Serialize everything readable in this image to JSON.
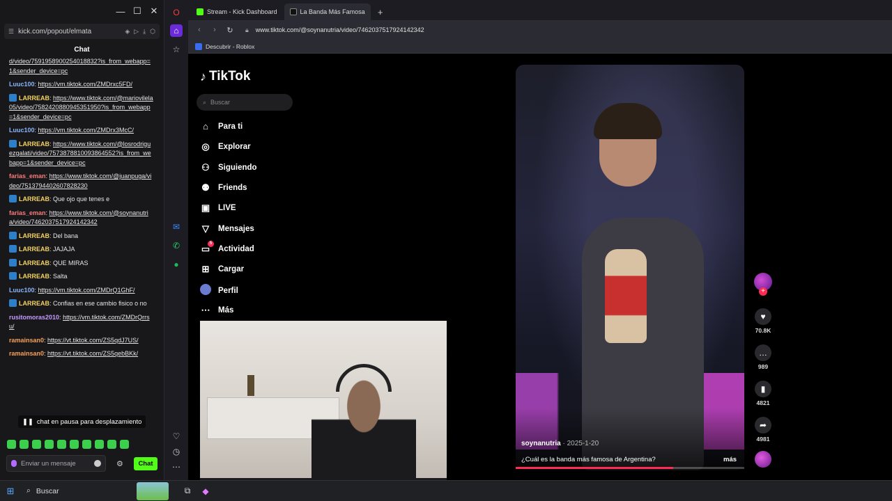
{
  "chat_window": {
    "url": "kick.com/popout/elmata",
    "header": "Chat",
    "messages": [
      {
        "user": "",
        "text": "d/video/7591958900254018832?is_from_webapp=1&sender_device=pc",
        "link": true,
        "color": "",
        "badge": false
      },
      {
        "user": "Luuc100",
        "text": "https://vm.tiktok.com/ZMDrxc5FD/",
        "link": true,
        "color": "blue",
        "badge": false
      },
      {
        "user": "LARREAB",
        "text": "https://www.tiktok.com/@mariovilela05/video/7582420880945351950?is_from_webapp=1&sender_device=pc",
        "link": true,
        "color": "yel",
        "badge": true
      },
      {
        "user": "Luuc100",
        "text": "https://vm.tiktok.com/ZMDrx3McC/",
        "link": true,
        "color": "blue",
        "badge": false
      },
      {
        "user": "LARREAB",
        "text": "https://www.tiktok.com/@losrodriguezgalati/video/7573878810093864552?is_from_webapp=1&sender_device=pc",
        "link": true,
        "color": "yel",
        "badge": true
      },
      {
        "user": "farias_eman",
        "text": "https://www.tiktok.com/@juanpuga/video/7513794402607828230",
        "link": true,
        "color": "red",
        "badge": false
      },
      {
        "user": "LARREAB",
        "text": "Que ojo que tenes e",
        "link": false,
        "color": "yel",
        "badge": true
      },
      {
        "user": "farias_eman",
        "text": "https://www.tiktok.com/@soynanutria/video/7462037517924142342",
        "link": true,
        "color": "red",
        "badge": false
      },
      {
        "user": "LARREAB",
        "text": "Del bana",
        "link": false,
        "color": "yel",
        "badge": true
      },
      {
        "user": "LARREAB",
        "text": "JAJAJA",
        "link": false,
        "color": "yel",
        "badge": true
      },
      {
        "user": "LARREAB",
        "text": "QUE MIRAS",
        "link": false,
        "color": "yel",
        "badge": true
      },
      {
        "user": "LARREAB",
        "text": "Salta",
        "link": false,
        "color": "yel",
        "badge": true
      },
      {
        "user": "Luuc100",
        "text": "https://vm.tiktok.com/ZMDrQ1GhF/",
        "link": true,
        "color": "blue",
        "badge": false
      },
      {
        "user": "LARREAB",
        "text": "Confias en ese cambio fisico o no",
        "link": false,
        "color": "yel",
        "badge": true
      },
      {
        "user": "rusitomoras2010",
        "text": "https://vm.tiktok.com/ZMDrQrrsu/",
        "link": true,
        "color": "purp",
        "badge": false
      },
      {
        "user": "ramainsan0",
        "text": "https://vt.tiktok.com/ZS5qdJ7US/",
        "link": true,
        "color": "orange",
        "badge": false
      },
      {
        "user": "ramainsan0",
        "text": "https://vt.tiktok.com/ZS5qebBKk/",
        "link": true,
        "color": "orange",
        "badge": false
      }
    ],
    "pause_text": "chat en pausa para desplazamiento",
    "input_placeholder": "Enviar un mensaje",
    "send_label": "Chat"
  },
  "browser": {
    "tabs": [
      {
        "label": "Stream - Kick Dashboard",
        "active": false,
        "icon_color": "#53fc18"
      },
      {
        "label": "La Banda Más Famosa",
        "active": true,
        "icon_color": "#ffffff"
      }
    ],
    "url": "www.tiktok.com/@soynanutria/video/7462037517924142342",
    "bookmark": "Descubrir - Roblox"
  },
  "tiktok": {
    "logo": "TikTok",
    "search_placeholder": "Buscar",
    "nav": [
      {
        "label": "Para ti",
        "icon": "home-icon"
      },
      {
        "label": "Explorar",
        "icon": "compass-icon"
      },
      {
        "label": "Siguiendo",
        "icon": "following-icon"
      },
      {
        "label": "Friends",
        "icon": "friends-icon"
      },
      {
        "label": "LIVE",
        "icon": "live-icon"
      },
      {
        "label": "Mensajes",
        "icon": "messages-icon"
      },
      {
        "label": "Actividad",
        "icon": "activity-icon",
        "badge": "5"
      },
      {
        "label": "Cargar",
        "icon": "upload-icon"
      },
      {
        "label": "Perfil",
        "icon": "profile-icon"
      },
      {
        "label": "Más",
        "icon": "more-icon"
      }
    ],
    "video": {
      "author": "soynanutria",
      "date": "2025-1-20",
      "description": "¿Cuál es la banda más famosa de Argentina?",
      "more": "más",
      "progress": 0.69
    },
    "actions": {
      "likes": "70.8K",
      "comments": "989",
      "saves": "4821",
      "shares": "4981"
    }
  },
  "taskbar": {
    "search": "Buscar"
  }
}
